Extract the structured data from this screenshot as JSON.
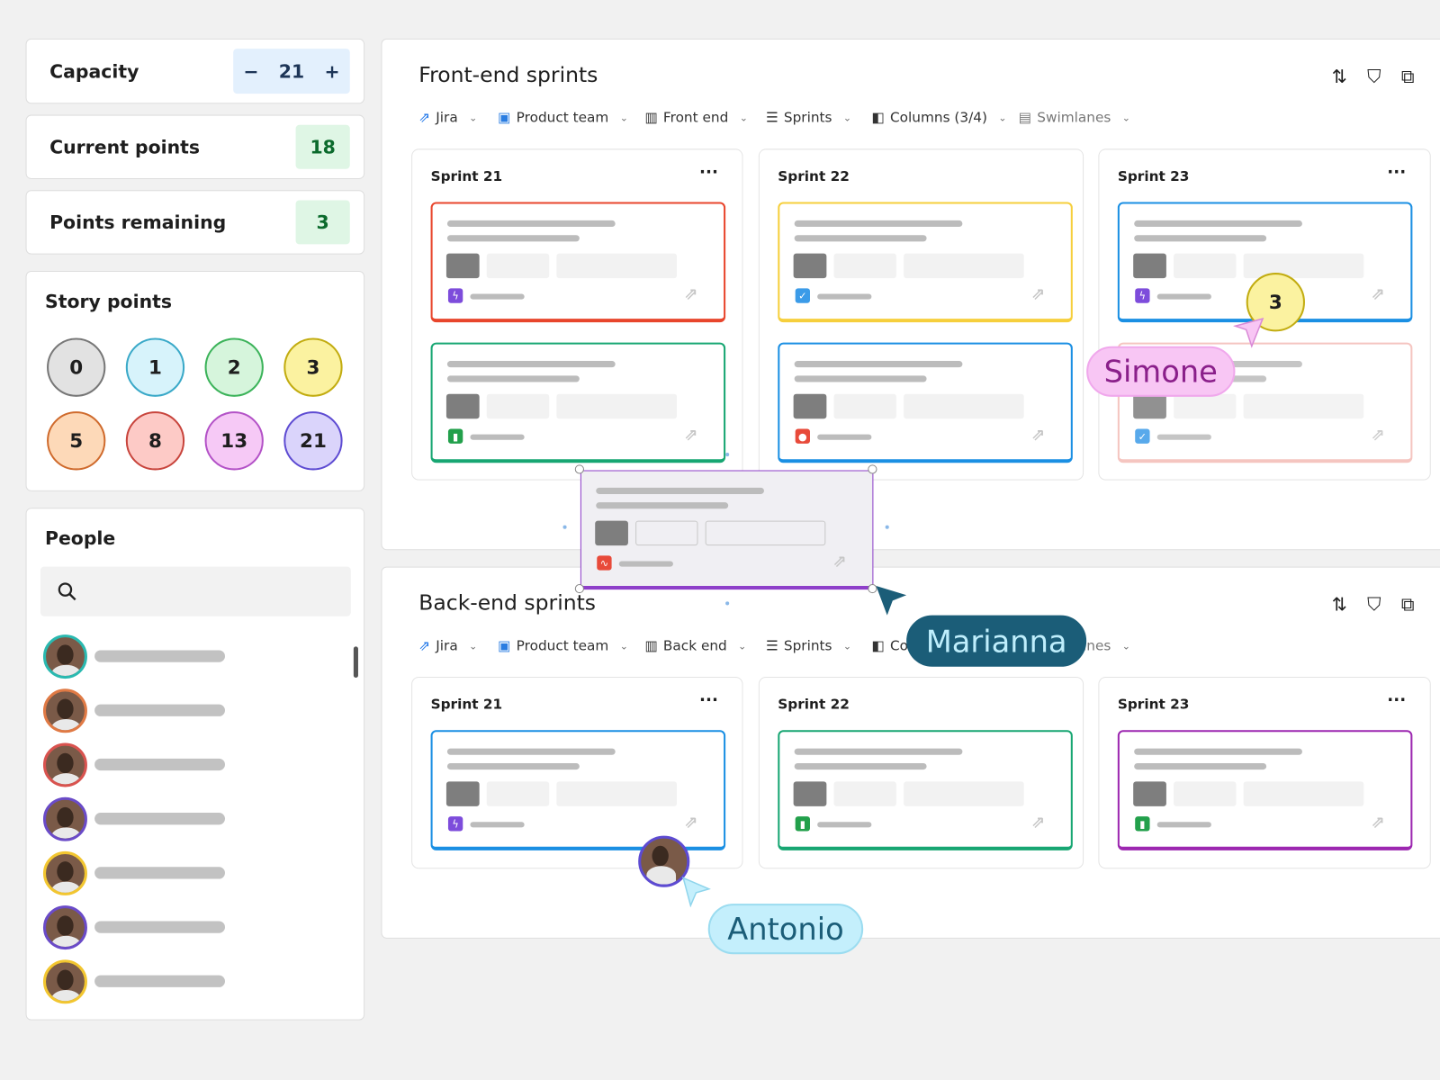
{
  "capacity": {
    "label": "Capacity",
    "value": "21",
    "minus": "−",
    "plus": "+"
  },
  "current_points": {
    "label": "Current points",
    "value": "18"
  },
  "points_remaining": {
    "label": "Points remaining",
    "value": "3"
  },
  "story_points": {
    "title": "Story points",
    "values": [
      {
        "v": "0",
        "bg": "#e2e2e2",
        "bd": "#777777"
      },
      {
        "v": "1",
        "bg": "#d7f3fb",
        "bd": "#3aa9c8"
      },
      {
        "v": "2",
        "bg": "#d6f5dc",
        "bd": "#3cb35a"
      },
      {
        "v": "3",
        "bg": "#fbf2a0",
        "bd": "#c2ac10"
      },
      {
        "v": "5",
        "bg": "#fdd9b8",
        "bd": "#cf6a2c"
      },
      {
        "v": "8",
        "bg": "#fdcac6",
        "bd": "#c8443c"
      },
      {
        "v": "13",
        "bg": "#f6c9f6",
        "bd": "#b352c7"
      },
      {
        "v": "21",
        "bg": "#dad4fb",
        "bd": "#5d4bd2"
      }
    ]
  },
  "people": {
    "title": "People",
    "search_placeholder": "",
    "avatar_borders": [
      "#2ab9b0",
      "#e07a45",
      "#d9534f",
      "#6a4bc8",
      "#f2c630",
      "#6a4bc8",
      "#f2c630"
    ]
  },
  "boards": [
    {
      "title": "Front-end sprints",
      "toolbar": [
        "Jira",
        "Product team",
        "Front end",
        "Sprints",
        "Columns (3/4)",
        "Swimlanes"
      ],
      "columns": [
        {
          "title": "Sprint 21",
          "more": "···",
          "cards": [
            {
              "border": "#e8452c",
              "icon": "lightning"
            },
            {
              "border": "#17a672",
              "icon": "bookmark"
            }
          ]
        },
        {
          "title": "Sprint 22",
          "more": "",
          "cards": [
            {
              "border": "#f6cf3c",
              "icon": "check"
            },
            {
              "border": "#1a8fe3",
              "icon": "bug"
            }
          ]
        },
        {
          "title": "Sprint 23",
          "more": "···",
          "cards": [
            {
              "border": "#1a8fe3",
              "icon": "lightning"
            },
            {
              "border": "#f4bcb6",
              "icon": "check"
            }
          ]
        }
      ]
    },
    {
      "title": "Back-end sprints",
      "toolbar": [
        "Jira",
        "Product team",
        "Back end",
        "Sprints",
        "Columns (3/4)",
        "Swimlanes"
      ],
      "columns": [
        {
          "title": "Sprint 21",
          "more": "···",
          "cards": [
            {
              "border": "#1a8fe3",
              "icon": "lightning"
            }
          ]
        },
        {
          "title": "Sprint 22",
          "more": "",
          "cards": [
            {
              "border": "#17a672",
              "icon": "bookmark"
            }
          ]
        },
        {
          "title": "Sprint 23",
          "more": "···",
          "cards": [
            {
              "border": "#9c27b0",
              "icon": "bookmark"
            }
          ]
        }
      ]
    }
  ],
  "dragged_card": {
    "border": "#8e3fc9",
    "icon": "pulse"
  },
  "collaborators": {
    "simone": {
      "name": "Simone",
      "bg": "#f8c6f4",
      "fg": "#8a1f8a",
      "point_badge": "3"
    },
    "marianna": {
      "name": "Marianna",
      "bg": "#1b5d78",
      "fg": "#bfeefc"
    },
    "antonio": {
      "name": "Antonio",
      "bg": "#c4effc",
      "fg": "#1b5d78"
    }
  }
}
